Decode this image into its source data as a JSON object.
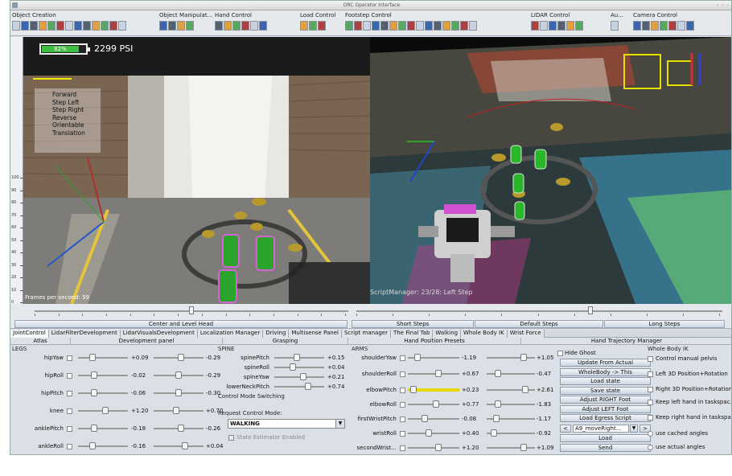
{
  "window": {
    "title": "DRC Operator Interface",
    "controls": "◦ ◦ ◦"
  },
  "toolbar": {
    "groups": [
      {
        "label": "Object Creation",
        "count": 13
      },
      {
        "label": "Object Manipulat...",
        "count": 4
      },
      {
        "label": "Hand Control",
        "count": 6
      },
      {
        "label": "Load Control",
        "count": 3
      },
      {
        "label": "Footstep Control",
        "count": 15
      },
      {
        "label": "LIDAR Control",
        "count": 6
      },
      {
        "label": "Au...",
        "count": 1
      },
      {
        "label": "Camera Control",
        "count": 7
      }
    ]
  },
  "camera_view": {
    "battery_percent": "82%",
    "battery_level": 0.82,
    "pressure": "2299 PSI",
    "gait_menu": [
      "Forward",
      "Step Left",
      "Step Right",
      "Reverse",
      "Orientable",
      "Translation"
    ],
    "fps": "Frames per second: 59",
    "ruler_ticks": [
      "100",
      "90",
      "80",
      "70",
      "60",
      "50",
      "40",
      "30",
      "20",
      "10",
      "0"
    ]
  },
  "lidar_view": {
    "script_status": "ScriptManager: 23/28: Left Step"
  },
  "slider_bar": {
    "buttons": [
      "Center and Level Head",
      "Short Steps",
      "Default Steps",
      "Long Steps"
    ]
  },
  "tabs": [
    "JointControl",
    "LidarFilterDevelopment",
    "LidarVisualsDevelopment",
    "Localization Manager",
    "Driving",
    "Multisense Panel",
    "Script manager",
    "The Final Tab",
    "Walking",
    "Whole Body IK",
    "Wrist Force"
  ],
  "subtabs": [
    "Atlas",
    "Development panel",
    "Grasping",
    "Hand Position Presets",
    "Hand Trajectory Manager"
  ],
  "legs": {
    "title": "LEGS",
    "joints": [
      {
        "name": "hipYaw",
        "value": "+0.09",
        "limit": "-0.29"
      },
      {
        "name": "hipRoll",
        "value": "-0.02",
        "limit": "-0.29"
      },
      {
        "name": "hipPitch",
        "value": "-0.06",
        "limit": "-0.30"
      },
      {
        "name": "knee",
        "value": "+1.20",
        "limit": "+0.70"
      },
      {
        "name": "anklePitch",
        "value": "-0.18",
        "limit": "-0.26"
      },
      {
        "name": "ankleRoll",
        "value": "-0.16",
        "limit": "+0.04"
      }
    ]
  },
  "spine": {
    "title": "SPINE",
    "joints": [
      {
        "name": "spinePitch",
        "value": "+0.15"
      },
      {
        "name": "spineRoll",
        "value": "+0.04"
      },
      {
        "name": "spineYaw",
        "value": "+0.21"
      },
      {
        "name": "lowerNeckPitch",
        "value": "+0.74"
      }
    ]
  },
  "control_mode": {
    "title": "Control Mode Switching",
    "request_label": "Request Control Mode:",
    "selected": "WALKING",
    "state_estimator": "State Estimator Enabled"
  },
  "arms": {
    "title": "ARMS",
    "joints": [
      {
        "name": "shoulderYaw",
        "value": "-1.19",
        "limit": "+1.05"
      },
      {
        "name": "shoulderRoll",
        "value": "+0.67",
        "limit": "-0.47"
      },
      {
        "name": "elbowPitch",
        "value": "+0.23",
        "limit": "+2.61"
      },
      {
        "name": "elbowRoll",
        "value": "+0.77",
        "limit": "-1.83"
      },
      {
        "name": "firstWristPitch",
        "value": "-0.08",
        "limit": "-1.17"
      },
      {
        "name": "wristRoll",
        "value": "+0.40",
        "limit": "-0.92"
      },
      {
        "name": "secondWrist...",
        "value": "+1.20",
        "limit": "+1.09"
      }
    ]
  },
  "presets": {
    "hide_ghost": "Hide Ghost",
    "buttons": [
      "Update From Actual",
      "WholeBody -> This",
      "Load state",
      "Save state",
      "Adjust RIGHT Foot",
      "Adjust LEFT Foot",
      "Load Egress Script"
    ],
    "script_select": "A9_moveRight...",
    "prev": "<",
    "next": ">",
    "load": "Load",
    "send": "Send"
  },
  "whole_body_ik": {
    "title": "Whole Body IK",
    "options": [
      "Control manual pelvis",
      "Left 3D Position+Rotation",
      "Right 3D Position+Rotation",
      "Keep left hand in taskspac...",
      "Keep right hand in taskspa..."
    ],
    "radios": [
      "use cached angles",
      "use actual angles"
    ]
  }
}
